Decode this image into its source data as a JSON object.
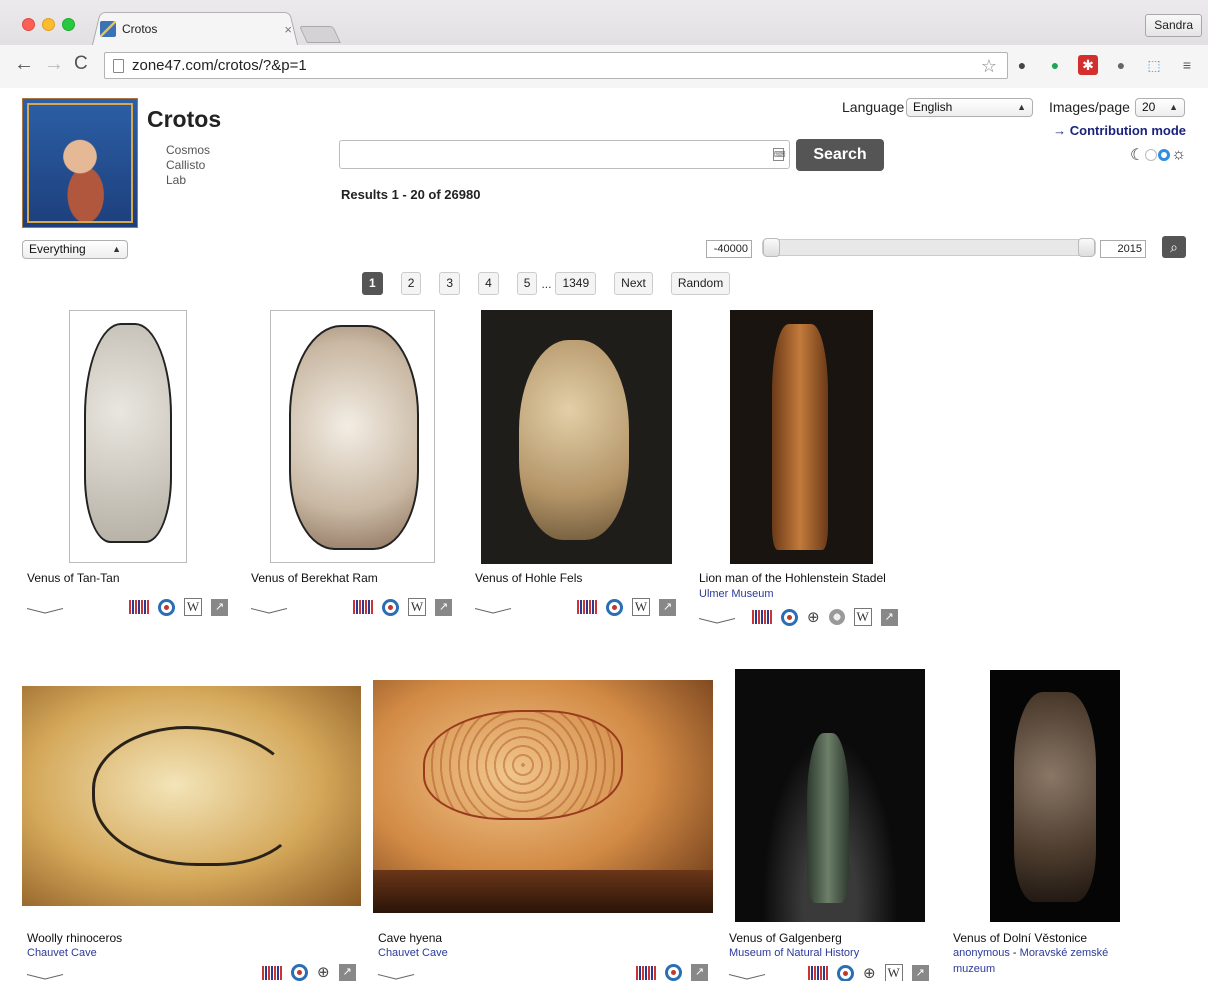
{
  "browser": {
    "tab_title": "Crotos",
    "tab_close": "×",
    "profile": "Sandra",
    "url": "zone47.com/crotos/?&p=1",
    "nav": {
      "back": "←",
      "forward": "→",
      "reload": "C"
    }
  },
  "header": {
    "title": "Crotos",
    "sublinks": [
      "Cosmos",
      "Callisto",
      "Lab"
    ],
    "language_label": "Language",
    "language_value": "English",
    "images_per_page_label": "Images/page",
    "images_per_page_value": "20",
    "contribution_link": "→ Contribution mode",
    "search_button": "Search",
    "search_value": "",
    "results_text": "Results 1 - 20 of 26980",
    "type_filter": "Everything"
  },
  "range": {
    "from": "-40000",
    "to": "2015",
    "from_fraction": 0.0,
    "to_fraction": 1.0
  },
  "pager": {
    "pages": [
      "1",
      "2",
      "3",
      "4",
      "5"
    ],
    "ellipsis": "...",
    "last": "1349",
    "next": "Next",
    "random": "Random",
    "active": "1"
  },
  "results": [
    {
      "title": "Venus of Tan-Tan",
      "sub": ""
    },
    {
      "title": "Venus of Berekhat Ram",
      "sub": ""
    },
    {
      "title": "Venus of Hohle Fels",
      "sub": ""
    },
    {
      "title": "Lion man of the Hohlenstein Stadel",
      "sub": "Ulmer Museum"
    },
    {
      "title": "Woolly rhinoceros",
      "sub": "Chauvet Cave"
    },
    {
      "title": "Cave hyena",
      "sub": "Chauvet Cave"
    },
    {
      "title": "Venus of Galgenberg",
      "sub": "Museum of Natural History"
    },
    {
      "title": "Venus of Dolní Věstonice",
      "sub_author": "anonymous",
      "sub_sep": " - ",
      "sub": "Moravské zemské",
      "sub2": "muzeum"
    }
  ],
  "icons": {
    "wiki_letter": "W",
    "zoom": "⊕",
    "ext": "↗"
  }
}
